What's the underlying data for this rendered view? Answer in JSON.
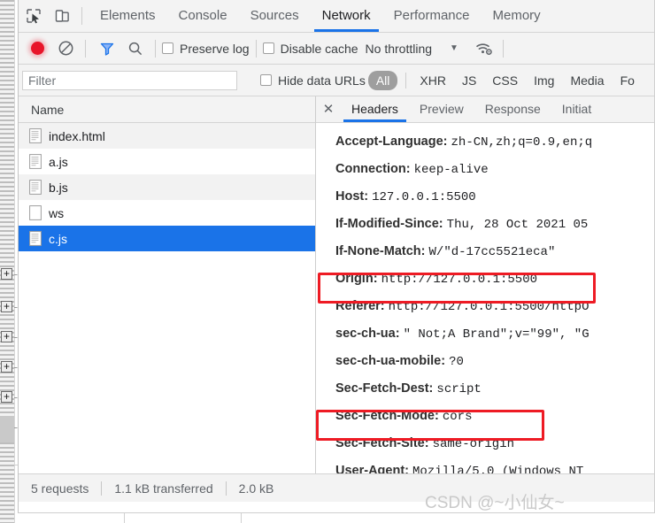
{
  "main_tabs": [
    {
      "label": "Elements",
      "active": false
    },
    {
      "label": "Console",
      "active": false
    },
    {
      "label": "Sources",
      "active": false
    },
    {
      "label": "Network",
      "active": true
    },
    {
      "label": "Performance",
      "active": false
    },
    {
      "label": "Memory",
      "active": false
    }
  ],
  "toolbar": {
    "record_title": "record-button",
    "clear_title": "clear-button",
    "filter_title": "filter-button",
    "search_title": "search-button",
    "preserve_log_label": "Preserve log",
    "disable_cache_label": "Disable cache",
    "throttling_value": "No throttling",
    "caret": "▼"
  },
  "filter_bar": {
    "placeholder": "Filter",
    "value": "",
    "hide_data_urls_label": "Hide data URLs",
    "types": [
      {
        "label": "All",
        "selected": true
      },
      {
        "label": "XHR",
        "selected": false
      },
      {
        "label": "JS",
        "selected": false
      },
      {
        "label": "CSS",
        "selected": false
      },
      {
        "label": "Img",
        "selected": false
      },
      {
        "label": "Media",
        "selected": false
      },
      {
        "label": "Fo",
        "selected": false
      }
    ]
  },
  "requests": {
    "column_header": "Name",
    "rows": [
      {
        "name": "index.html",
        "selected": false,
        "icon": "document-icon"
      },
      {
        "name": "a.js",
        "selected": false,
        "icon": "document-icon"
      },
      {
        "name": "b.js",
        "selected": false,
        "icon": "document-icon"
      },
      {
        "name": "ws",
        "selected": false,
        "icon": "blank-document-icon"
      },
      {
        "name": "c.js",
        "selected": true,
        "icon": "document-icon"
      }
    ]
  },
  "detail": {
    "close_label": "✕",
    "tabs": [
      {
        "label": "Headers",
        "active": true
      },
      {
        "label": "Preview",
        "active": false
      },
      {
        "label": "Response",
        "active": false
      },
      {
        "label": "Initiat",
        "active": false
      }
    ],
    "headers": [
      {
        "name": "Accept-Language:",
        "value": "zh-CN,zh;q=0.9,en;q"
      },
      {
        "name": "Connection:",
        "value": "keep-alive"
      },
      {
        "name": "Host:",
        "value": "127.0.0.1:5500"
      },
      {
        "name": "If-Modified-Since:",
        "value": "Thu, 28 Oct 2021 05"
      },
      {
        "name": "If-None-Match:",
        "value": "W/\"d-17cc5521eca\""
      },
      {
        "name": "Origin:",
        "value": "http://127.0.0.1:5500"
      },
      {
        "name": "Referer:",
        "value": "http://127.0.0.1:5500/httpO"
      },
      {
        "name": "sec-ch-ua:",
        "value": "\" Not;A Brand\";v=\"99\", \"G"
      },
      {
        "name": "sec-ch-ua-mobile:",
        "value": "?0"
      },
      {
        "name": "Sec-Fetch-Dest:",
        "value": "script"
      },
      {
        "name": "Sec-Fetch-Mode:",
        "value": "cors"
      },
      {
        "name": "Sec-Fetch-Site:",
        "value": "same-origin"
      },
      {
        "name": "User-Agent:",
        "value": "Mozilla/5.0 (Windows NT"
      }
    ]
  },
  "status": {
    "requests": "5 requests",
    "transferred": "1.1 kB transferred",
    "resources": "2.0 kB"
  },
  "watermark": "CSDN @~小仙女~",
  "colors": {
    "accent_blue": "#1a73e8",
    "record_red": "#e8152a",
    "annotation_red": "#ee1b24",
    "toolbar_bg": "#f3f3f3"
  }
}
